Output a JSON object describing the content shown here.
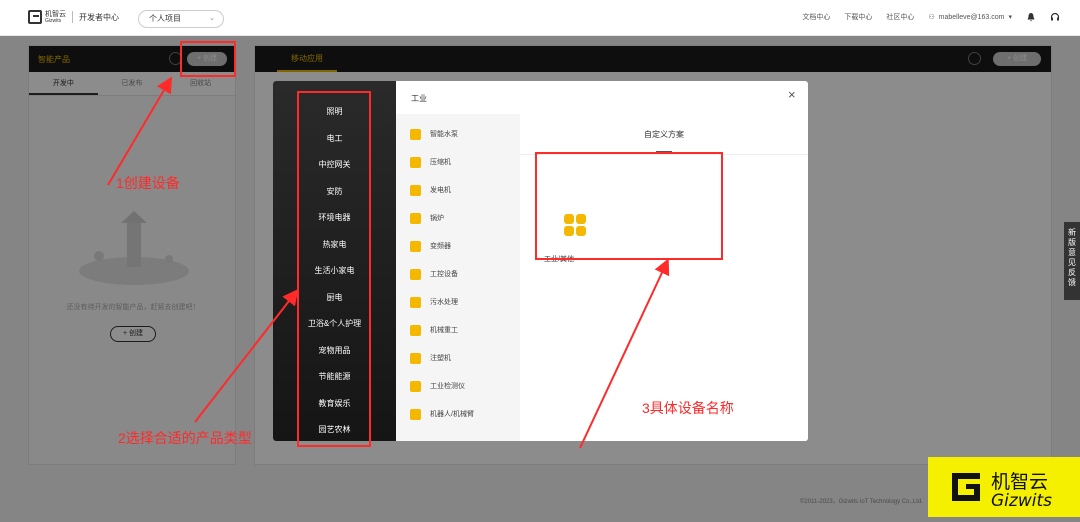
{
  "topbar": {
    "logo_text": "机智云",
    "logo_sub": "Gizwits",
    "dev_center": "开发者中心",
    "project_select": "个人项目",
    "links": [
      "文档中心",
      "下载中心",
      "社区中心"
    ],
    "user_email": "mabelleve@163.com"
  },
  "left_panel": {
    "title": "智能产品",
    "create_label": "+ 创建",
    "tabs": [
      "开发中",
      "已发布",
      "回收站"
    ],
    "empty_text": "还没有待开发的智能产品，赶紧去创建吧！",
    "empty_create": "+ 创建"
  },
  "right_panel": {
    "tab": "移动应用",
    "create_label": "+ 创建"
  },
  "modal": {
    "title": "工业",
    "categories": [
      "照明",
      "电工",
      "中控网关",
      "安防",
      "环境电器",
      "热家电",
      "生活小家电",
      "厨电",
      "卫浴&个人护理",
      "宠物用品",
      "节能能源",
      "教育娱乐",
      "园艺农林"
    ],
    "subcategories": [
      "智能水泵",
      "压缩机",
      "发电机",
      "锅炉",
      "变频器",
      "工控设备",
      "污水处理",
      "机械重工",
      "注塑机",
      "工业检测仪",
      "机器人/机械臂"
    ],
    "custom_title": "自定义方案",
    "solution_label": "工业/其他"
  },
  "annotations": {
    "step1": "1创建设备",
    "step2": "2选择合适的产品类型",
    "step3": "3具体设备名称",
    "color": "#ff2a2a"
  },
  "feedback": "新版意见反馈",
  "copyright": "©2011-2023，Gizwits IoT Technology Co.,Ltd.",
  "watermark": {
    "cn": "机智云",
    "en": "Gizwits"
  },
  "colors": {
    "accent": "#f5b800",
    "dark": "#1a1a1a"
  }
}
